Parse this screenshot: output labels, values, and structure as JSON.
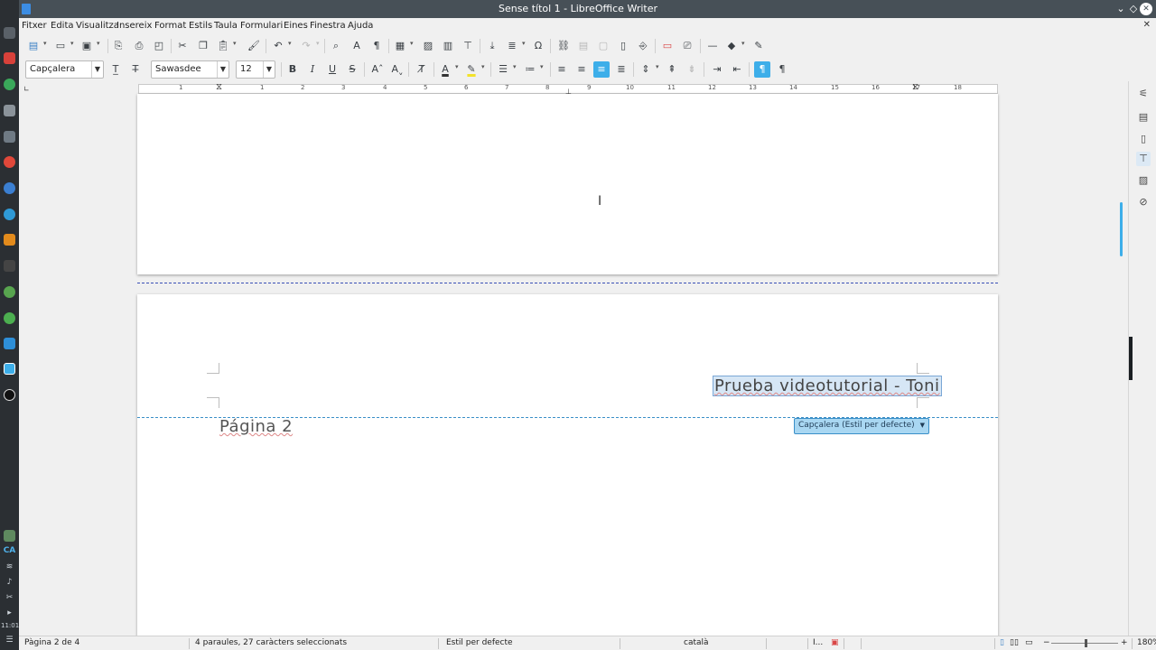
{
  "window": {
    "title": "Sense títol 1 - LibreOffice Writer"
  },
  "menu": [
    "Fitxer",
    "Edita",
    "Visualitza",
    "Insereix",
    "Format",
    "Estils",
    "Taula",
    "Formulari",
    "Eines",
    "Finestra",
    "Ajuda"
  ],
  "format_bar": {
    "paragraph_style": "Capçalera",
    "font_name": "Sawasdee",
    "font_size": "12"
  },
  "ruler": {
    "numbers": [
      "1",
      "1",
      "2",
      "3",
      "4",
      "5",
      "6",
      "7",
      "8",
      "9",
      "10",
      "11",
      "12",
      "13",
      "14",
      "15",
      "16",
      "17",
      "18"
    ]
  },
  "document": {
    "header_text": "Prueba videotutorial - Toni",
    "header_tag": "Capçalera (Estil per defecte)",
    "body_text": "Página 2"
  },
  "panel": {
    "lang_code": "CA",
    "clock": "11:01"
  },
  "status": {
    "page": "Pàgina 2 de 4",
    "selection": "4 paraules, 27 caràcters seleccionats",
    "page_style": "Estil per defecte",
    "language": "català",
    "insert_mode": "I...",
    "zoom_minus": "−",
    "zoom_plus": "+",
    "zoom": "180%"
  },
  "colors": {
    "accent": "#3daee9",
    "titlebar": "#475057",
    "panel": "#2b2f33"
  }
}
